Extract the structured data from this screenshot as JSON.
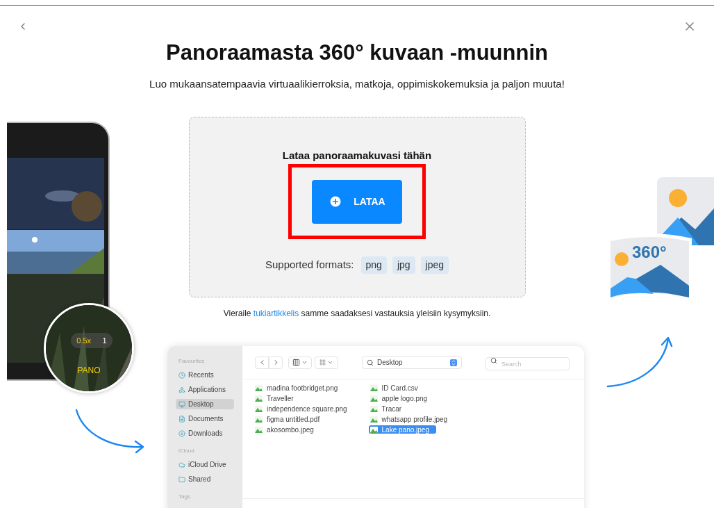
{
  "title": "Panoraamasta 360° kuvaan -muunnin",
  "subtitle": "Luo mukaansatempaavia virtuaalikierroksia, matkoja, oppimiskokemuksia ja paljon muuta!",
  "upload": {
    "heading": "Lataa panoraamakuvasi tähän",
    "button": {
      "label": "LATAA",
      "highlighted": true
    },
    "formats_label": "Supported formats:",
    "formats": [
      "png",
      "jpg",
      "jpeg"
    ]
  },
  "help": {
    "before": "Vieraile",
    "link": "tukiartikkelis",
    "after": "samme saadaksesi vastauksia yleisiin kysymyksiin."
  },
  "phone": {
    "zoom_options": [
      {
        "label": "0.5x",
        "selected": true
      },
      {
        "label": "1",
        "selected": false
      }
    ],
    "mode": "PANO"
  },
  "badge": {
    "label": "360°"
  },
  "finder": {
    "sidebar": [
      {
        "heading": "Favourites",
        "items": [
          {
            "label": "Recents",
            "selected": false
          },
          {
            "label": "Applications",
            "selected": false
          },
          {
            "label": "Desktop",
            "selected": true
          },
          {
            "label": "Documents",
            "selected": false
          },
          {
            "label": "Downloads",
            "selected": false
          }
        ]
      },
      {
        "heading": "iCloud",
        "items": [
          {
            "label": "iCloud Drive",
            "selected": false
          },
          {
            "label": "Shared",
            "selected": false
          }
        ]
      },
      {
        "heading": "Tags"
      }
    ],
    "location": "Desktop",
    "search": {
      "placeholder": "Search"
    },
    "files": [
      {
        "name": "madina footbridget.png",
        "selected": false
      },
      {
        "name": "Traveller",
        "selected": false
      },
      {
        "name": "independence square.png",
        "selected": false
      },
      {
        "name": "figma untitled.pdf",
        "selected": false
      },
      {
        "name": "akosombo.jpeg",
        "selected": false
      },
      {
        "name": "ID Card.csv",
        "selected": false
      },
      {
        "name": "apple logo.png",
        "selected": false
      },
      {
        "name": "Tracar",
        "selected": false
      },
      {
        "name": "whatsapp profile.jpeg",
        "selected": false
      },
      {
        "name": "Lake pano.jpeg",
        "selected": true
      }
    ]
  }
}
